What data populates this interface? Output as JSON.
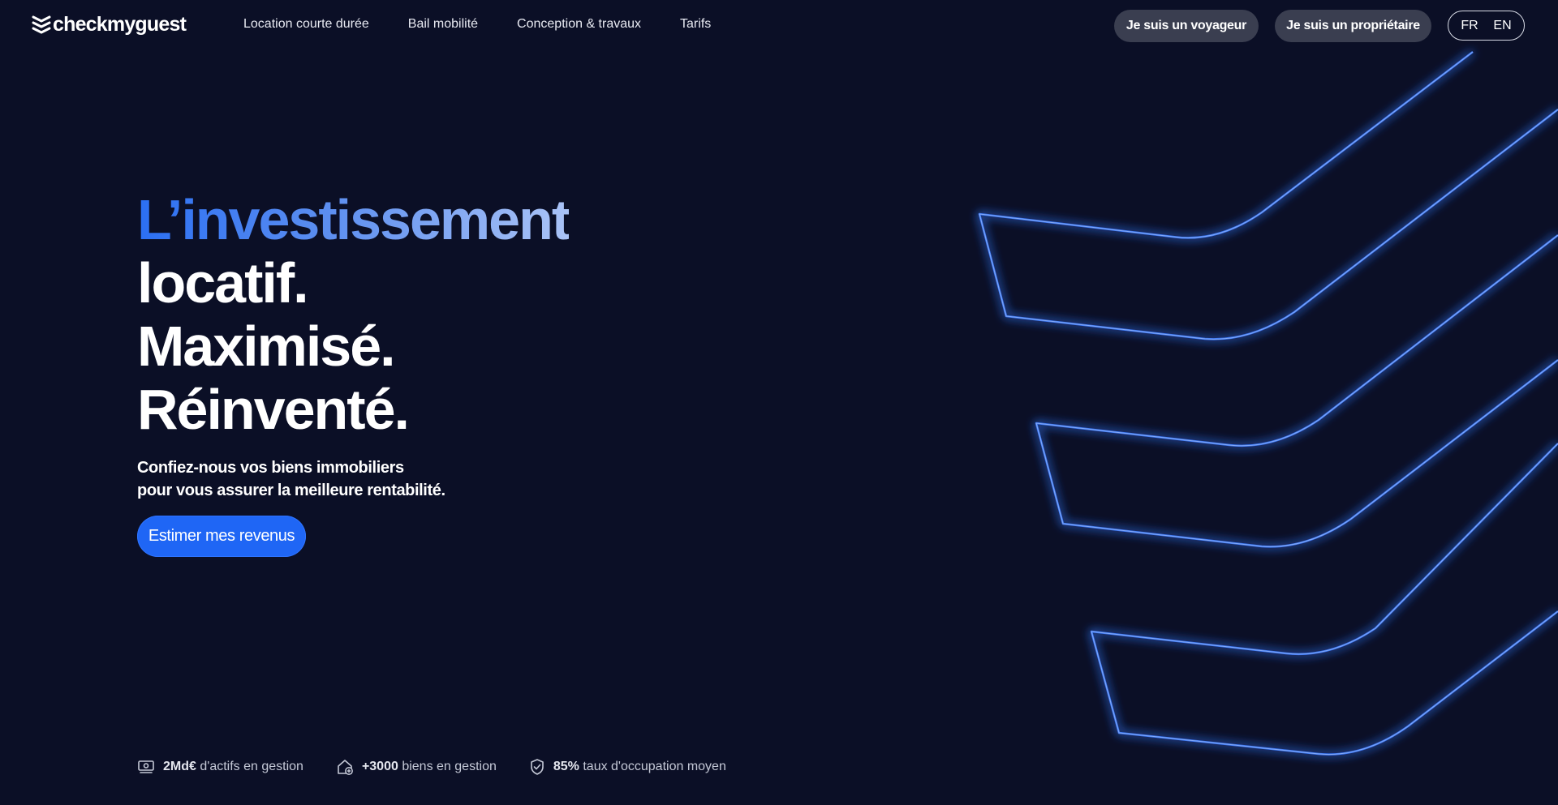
{
  "header": {
    "logo_text": "checkmyguest",
    "nav": [
      {
        "label": "Location courte durée"
      },
      {
        "label": "Bail mobilité"
      },
      {
        "label": "Conception & travaux"
      },
      {
        "label": "Tarifs"
      }
    ],
    "traveler_button": "Je suis un voyageur",
    "owner_button": "Je suis un propriétaire",
    "languages": [
      "FR",
      "EN"
    ]
  },
  "hero": {
    "title_line1": "L’investissement",
    "title_line2": "locatif.",
    "title_line3": "Maximisé.",
    "title_line4": "Réinventé.",
    "subtitle_line1": "Confiez-nous vos biens immobiliers",
    "subtitle_line2": "pour vous assurer la meilleure rentabilité.",
    "cta_label": "Estimer mes revenus"
  },
  "stats": [
    {
      "value": "2Md€",
      "text": "d'actifs en gestion",
      "icon": "money-icon"
    },
    {
      "value": "+3000",
      "text": "biens en gestion",
      "icon": "house-plus-icon"
    },
    {
      "value": "85%",
      "text": "taux d'occupation moyen",
      "icon": "shield-check-icon"
    }
  ],
  "colors": {
    "background": "#0b0f26",
    "accent": "#1f66f5",
    "pill": "#3a3e50",
    "line_glow": "#2f6df5"
  }
}
